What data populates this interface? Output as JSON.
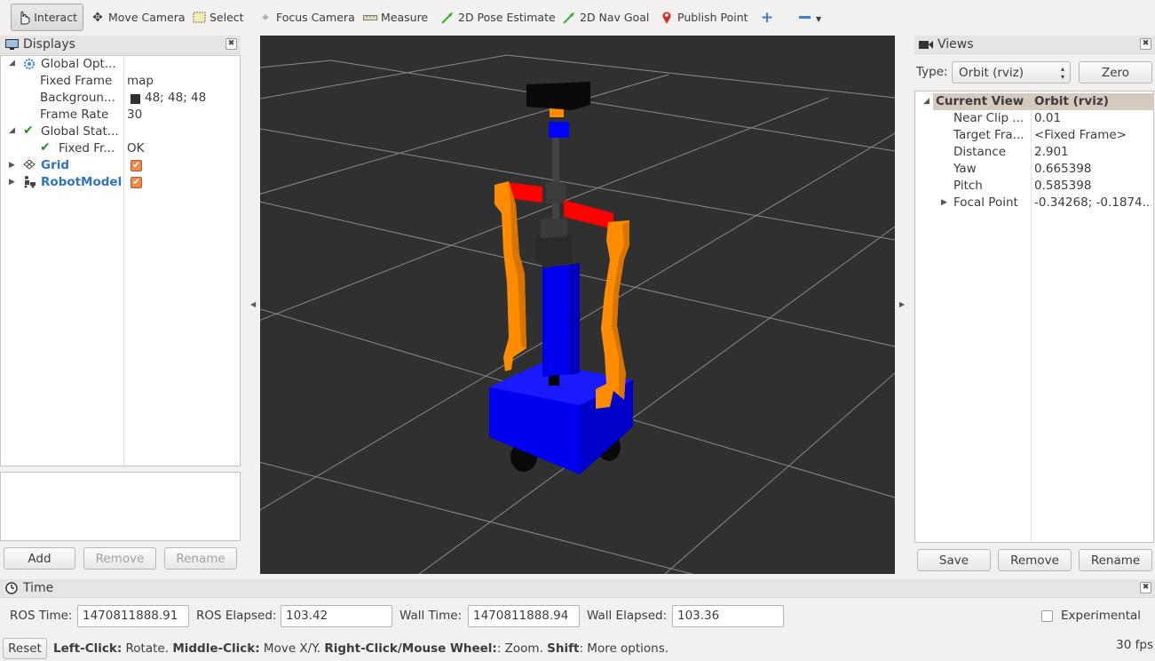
{
  "toolbar": {
    "interact": "Interact",
    "move_camera": "Move Camera",
    "select": "Select",
    "focus_camera": "Focus Camera",
    "measure": "Measure",
    "pose_estimate": "2D Pose Estimate",
    "nav_goal": "2D Nav Goal",
    "publish_point": "Publish Point"
  },
  "displays": {
    "title": "Displays",
    "items": [
      {
        "label": "Global Opt...",
        "value": ""
      },
      {
        "label": "Fixed Frame",
        "value": "map"
      },
      {
        "label": "Backgroun...",
        "value": "48; 48; 48"
      },
      {
        "label": "Frame Rate",
        "value": "30"
      },
      {
        "label": "Global Stat...",
        "value": ""
      },
      {
        "label": "Fixed Fr...",
        "value": "OK"
      },
      {
        "label": "Grid",
        "value": ""
      },
      {
        "label": "RobotModel",
        "value": ""
      }
    ],
    "buttons": {
      "add": "Add",
      "remove": "Remove",
      "rename": "Rename"
    }
  },
  "views": {
    "title": "Views",
    "type_label": "Type:",
    "type_value": "Orbit (rviz)",
    "zero_button": "Zero",
    "header": {
      "name": "Current View",
      "value": "Orbit (rviz)"
    },
    "rows": [
      {
        "label": "Near Clip ...",
        "value": "0.01"
      },
      {
        "label": "Target Fra...",
        "value": "<Fixed Frame>"
      },
      {
        "label": "Distance",
        "value": "2.901"
      },
      {
        "label": "Yaw",
        "value": "0.665398"
      },
      {
        "label": "Pitch",
        "value": "0.585398"
      },
      {
        "label": "Focal Point",
        "value": "-0.34268; -0.1874..."
      }
    ],
    "buttons": {
      "save": "Save",
      "remove": "Remove",
      "rename": "Rename"
    }
  },
  "time": {
    "title": "Time",
    "ros_time_label": "ROS Time:",
    "ros_time": "1470811888.91",
    "ros_elapsed_label": "ROS Elapsed:",
    "ros_elapsed": "103.42",
    "wall_time_label": "Wall Time:",
    "wall_time": "1470811888.94",
    "wall_elapsed_label": "Wall Elapsed:",
    "wall_elapsed": "103.36",
    "experimental": "Experimental"
  },
  "status": {
    "reset": "Reset",
    "left_click": "Left-Click:",
    "left_click_desc": " Rotate. ",
    "middle_click": "Middle-Click:",
    "middle_click_desc": " Move X/Y. ",
    "right_click": "Right-Click/Mouse Wheel:",
    "right_click_desc": ": Zoom. ",
    "shift": "Shift",
    "shift_desc": ": More options.",
    "fps": "30 fps"
  },
  "colors": {
    "background": "#303030",
    "grid": "#9a9a9a",
    "robot_base": "#0000ff",
    "robot_arm": "#ff8c00",
    "robot_red": "#ff0000",
    "checkbox": "#f08a4b",
    "link_blue": "#2f74c0"
  }
}
